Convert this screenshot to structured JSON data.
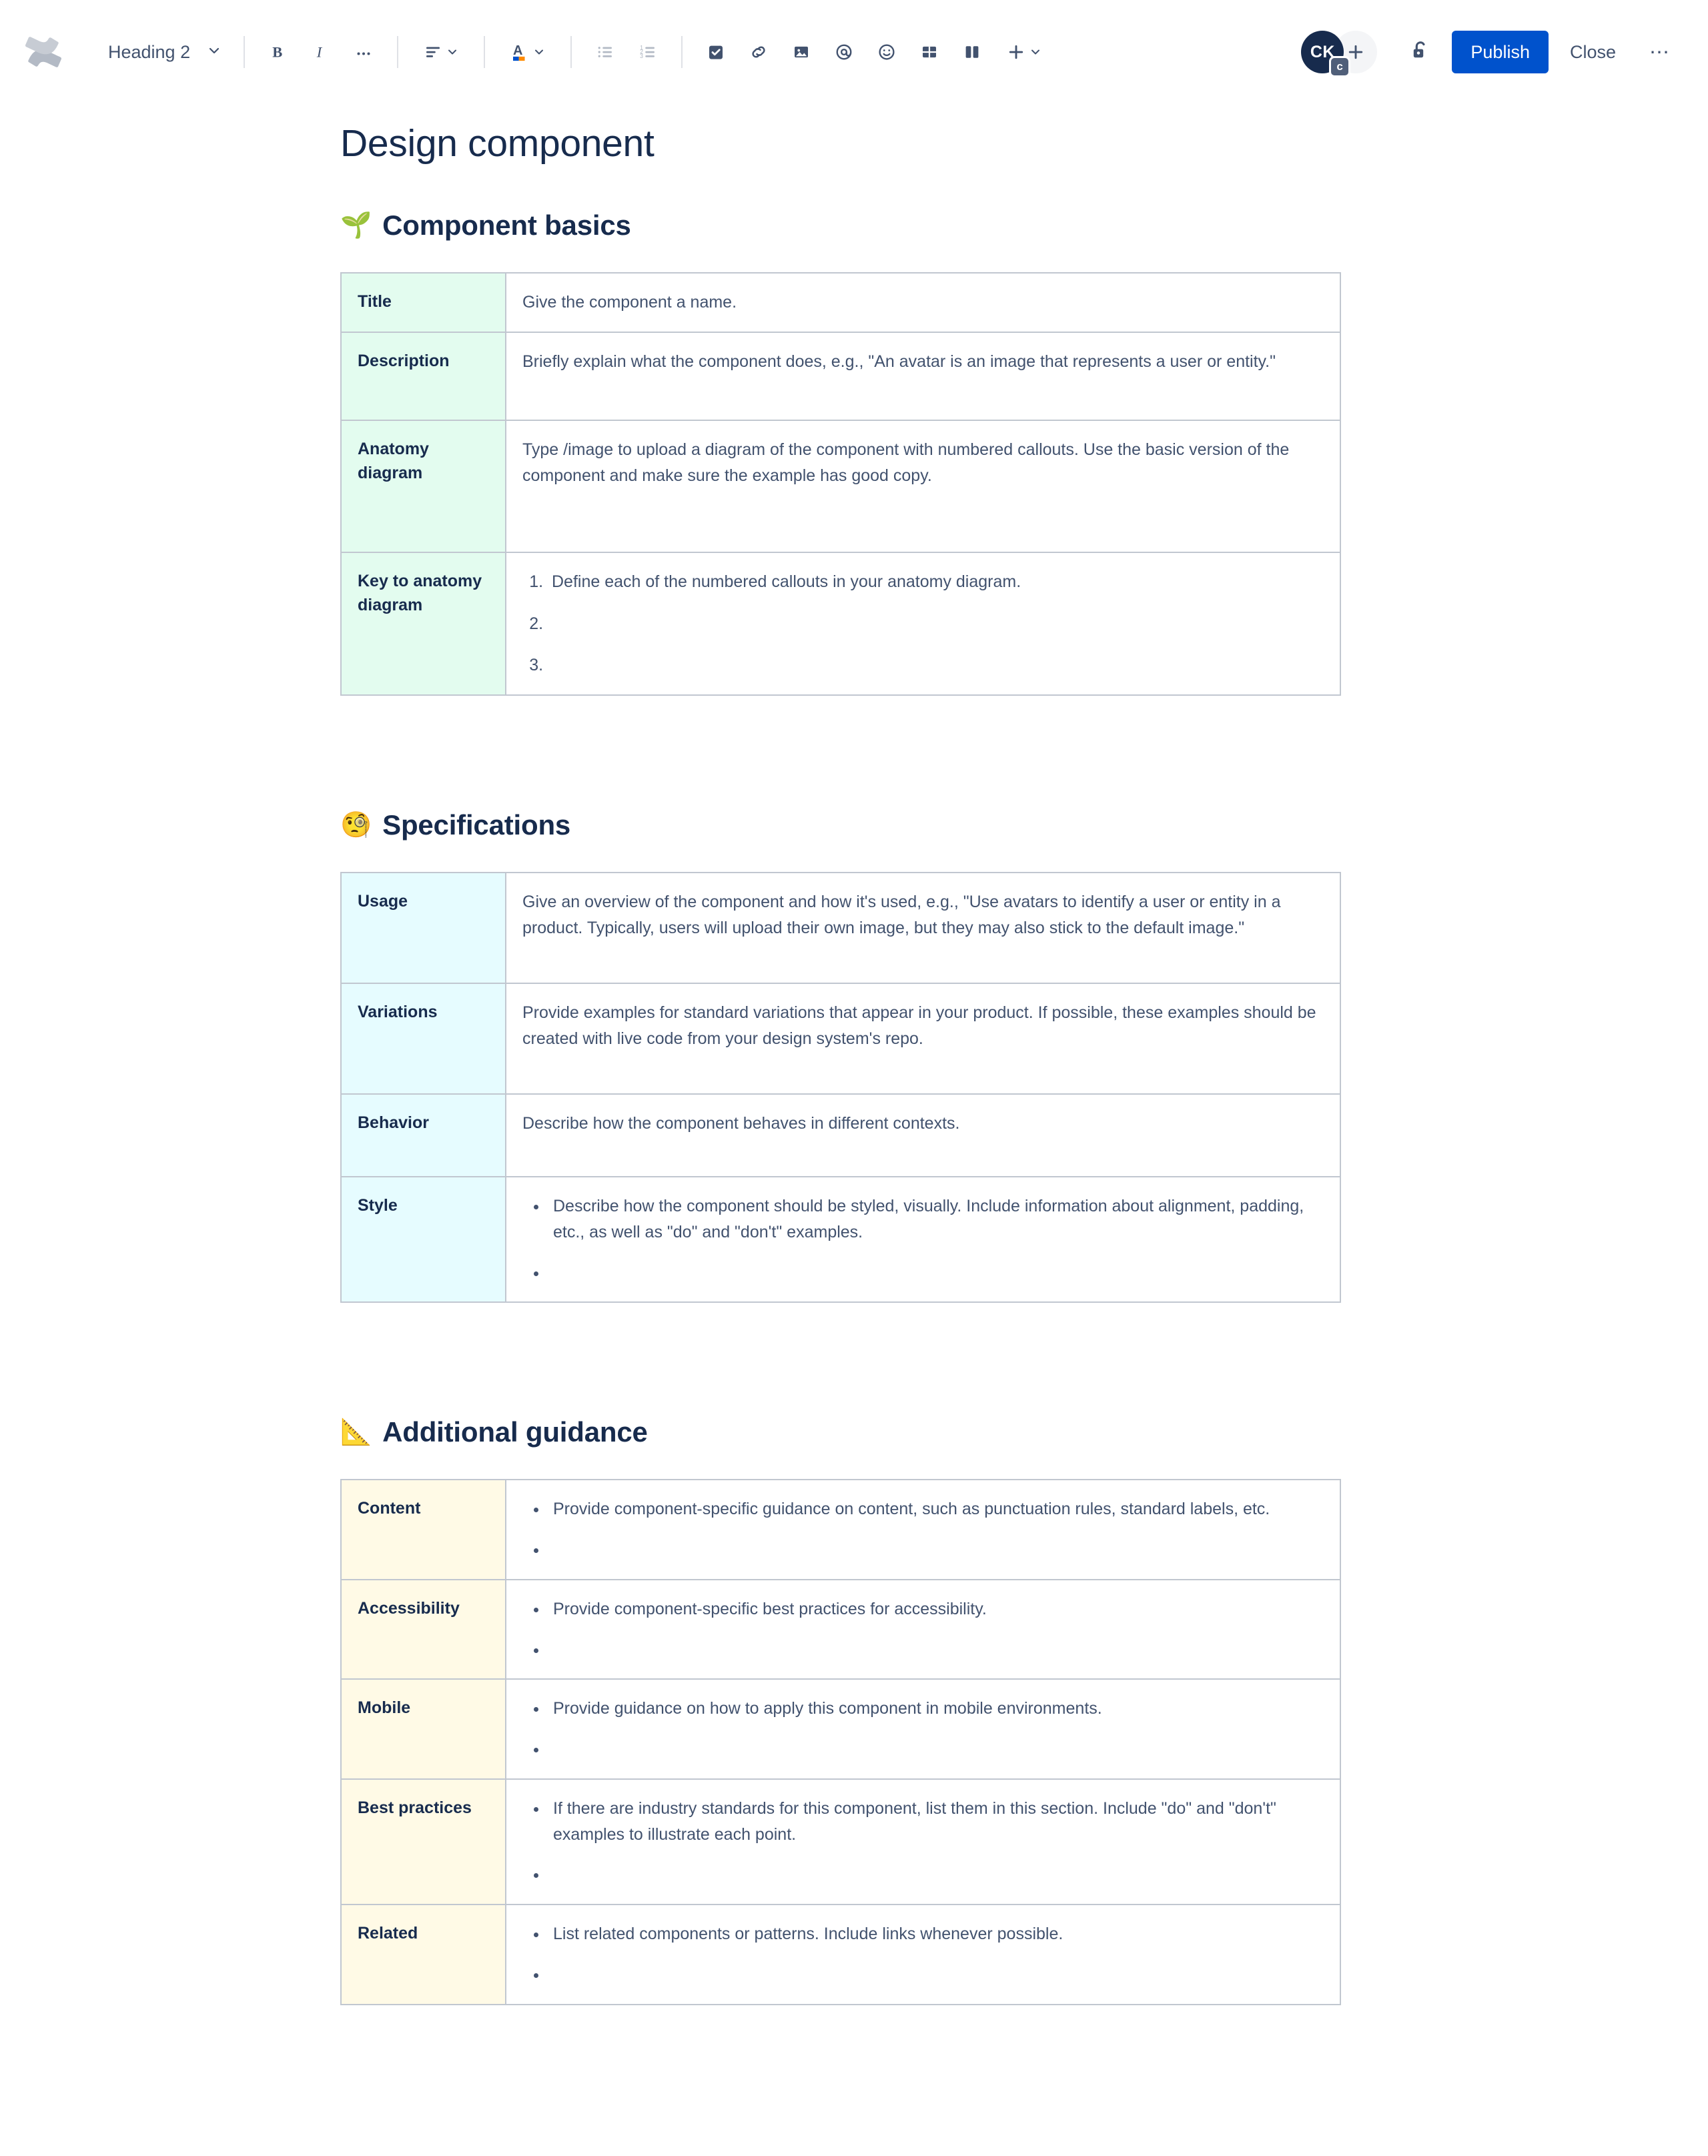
{
  "toolbar": {
    "logo_name": "confluence-logo",
    "heading_select": {
      "label": "Heading 2"
    },
    "buttons": {
      "bold": "B",
      "italic": "I",
      "more_formatting": "•••",
      "text_align": "text-align",
      "text_color": "A",
      "bullet_list": "bullet-list",
      "numbered_list": "numbered-list",
      "task_list": "task-list",
      "link": "link",
      "image": "image",
      "mention": "@",
      "emoji": "emoji",
      "table": "table",
      "layout": "layout",
      "insert": "+"
    },
    "avatar": {
      "initials": "CK",
      "badge": "c"
    },
    "add_people": "+",
    "restrictions": "unlock-icon",
    "publish_label": "Publish",
    "close_label": "Close",
    "more_label": "⋯"
  },
  "colors": {
    "brand_blue": "#0052cc",
    "text_dark": "#172b4d",
    "text_body": "#42526e",
    "border": "#c1c7d0",
    "green_cell": "#e3fcef",
    "blue_cell": "#e6fcff",
    "cream_cell": "#fffae6"
  },
  "document": {
    "title": "Design component",
    "sections": [
      {
        "emoji": "🌱",
        "emoji_name": "seedling-emoji",
        "heading": "Component basics",
        "color": "green",
        "rows": [
          {
            "key": "Title",
            "type": "text",
            "text": "Give the component a name."
          },
          {
            "key": "Description",
            "type": "text",
            "text": "Briefly explain what the component does, e.g., \"An avatar is an image that represents a user or entity.\""
          },
          {
            "key": "Anatomy diagram",
            "type": "text",
            "text": "Type /image to upload a diagram of the component with numbered callouts. Use the basic version of the component and make sure the example has good copy."
          },
          {
            "key": "Key to anatomy diagram",
            "type": "ordered",
            "items": [
              "Define each of the numbered callouts in your anatomy diagram.",
              "",
              ""
            ]
          }
        ]
      },
      {
        "emoji": "🧐",
        "emoji_name": "face-with-monocle-emoji",
        "heading": "Specifications",
        "color": "blue",
        "rows": [
          {
            "key": "Usage",
            "type": "text",
            "text": "Give an overview of the component and how it's used, e.g., \"Use avatars to identify a user or entity in a product. Typically, users will upload their own image, but they may also stick to the default image.\""
          },
          {
            "key": "Variations",
            "type": "text",
            "text": "Provide examples for standard variations that appear in your product. If possible, these examples should be created with live code from your design system's repo."
          },
          {
            "key": "Behavior",
            "type": "text",
            "text": "Describe how the component behaves in different contexts."
          },
          {
            "key": "Style",
            "type": "bullets",
            "items": [
              "Describe how the component should be styled, visually. Include information about alignment, padding, etc., as well as \"do\" and \"don't\" examples.",
              ""
            ]
          }
        ]
      },
      {
        "emoji": "📐",
        "emoji_name": "triangular-ruler-emoji",
        "heading": "Additional guidance",
        "color": "cream",
        "rows": [
          {
            "key": "Content",
            "type": "bullets",
            "items": [
              "Provide component-specific guidance on content, such as punctuation rules, standard labels, etc.",
              ""
            ]
          },
          {
            "key": "Accessibility",
            "type": "bullets",
            "items": [
              "Provide component-specific best practices for accessibility.",
              ""
            ]
          },
          {
            "key": "Mobile",
            "type": "bullets",
            "items": [
              "Provide guidance on how to apply this component in mobile environments.",
              ""
            ]
          },
          {
            "key": "Best practices",
            "type": "bullets",
            "items": [
              "If there are industry standards for this component, list them in this section. Include \"do\" and \"don't\" examples to illustrate each point.",
              ""
            ]
          },
          {
            "key": "Related",
            "type": "bullets",
            "items": [
              "List related components or patterns. Include links whenever possible.",
              ""
            ]
          }
        ]
      }
    ]
  }
}
